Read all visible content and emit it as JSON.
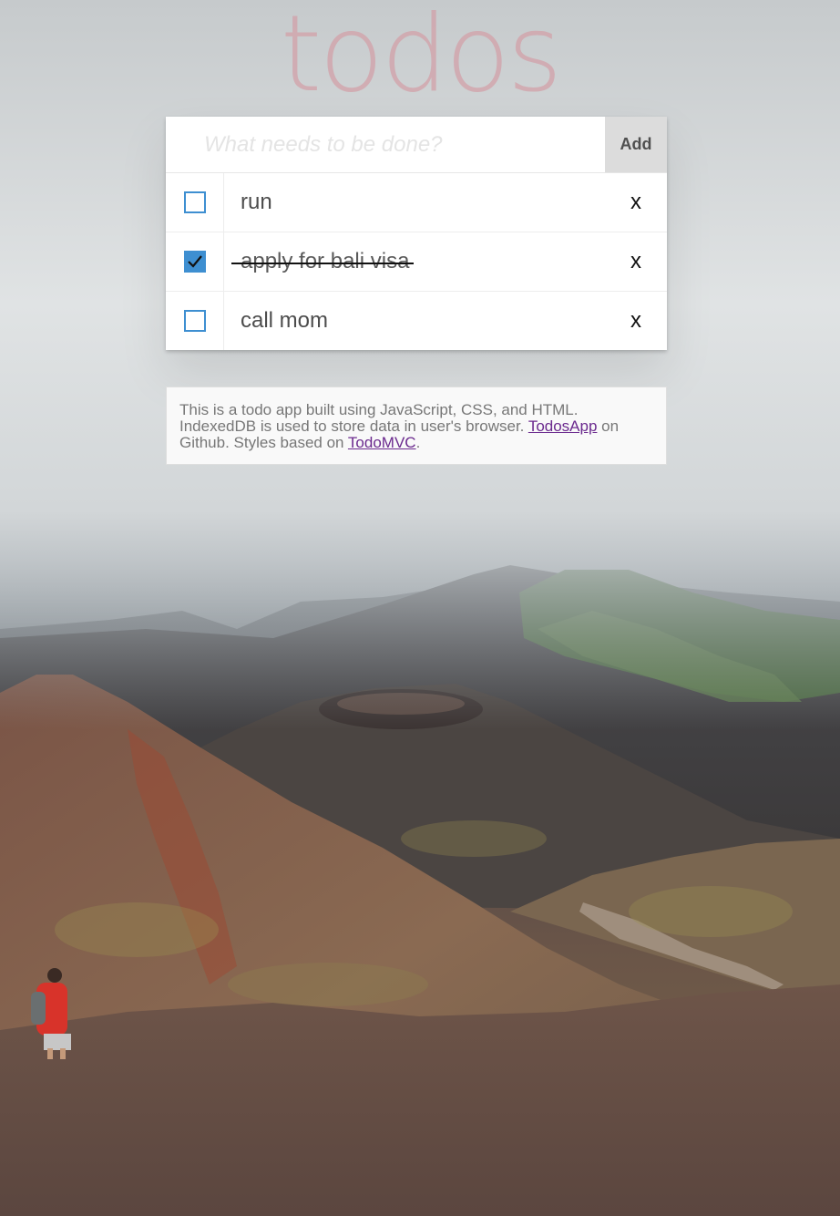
{
  "app": {
    "title": "todos"
  },
  "new_todo": {
    "placeholder": "What needs to be done?",
    "value": "",
    "add_label": "Add"
  },
  "todos": [
    {
      "label": "run",
      "completed": false,
      "delete_label": "x"
    },
    {
      "label": "apply for bali visa",
      "completed": true,
      "delete_label": "x"
    },
    {
      "label": "call mom",
      "completed": false,
      "delete_label": "x"
    }
  ],
  "info": {
    "text_1": "This is a todo app built using JavaScript, CSS, and HTML. IndexedDB is used to store data in user's browser. ",
    "link_1": "TodosApp",
    "text_2": " on Github. Styles based on ",
    "link_2": "TodoMVC",
    "text_3": "."
  },
  "colors": {
    "title": "#d2a0a8",
    "checkbox_accent": "#3e8fd1",
    "link": "#6b2a8e",
    "add_button_bg": "#dcdcdc"
  }
}
